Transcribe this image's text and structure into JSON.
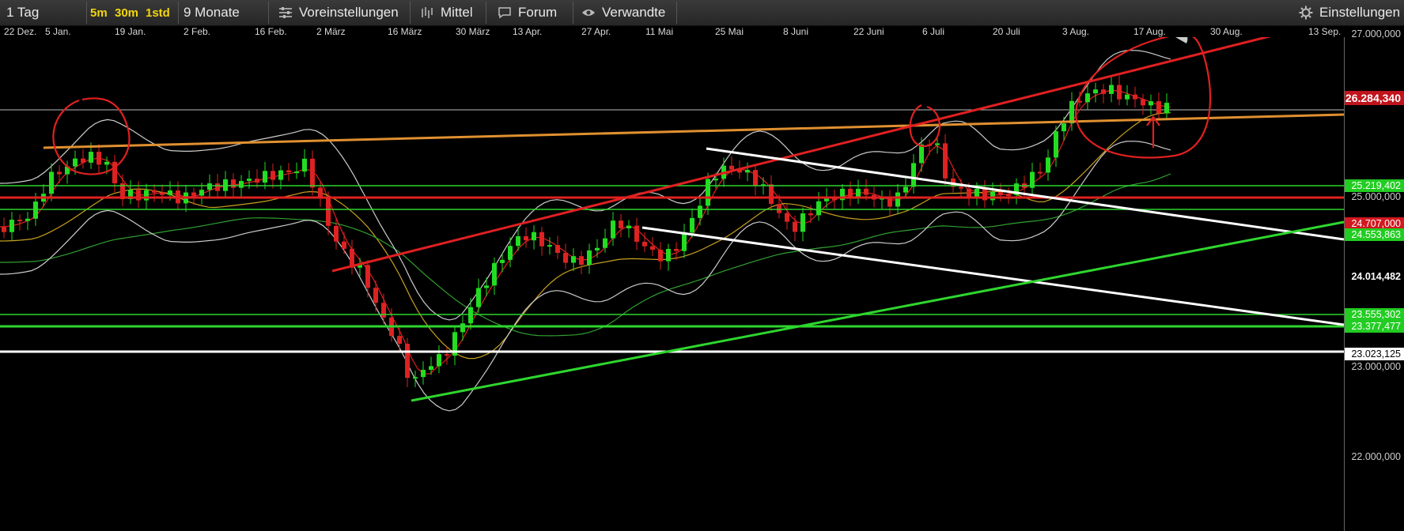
{
  "toolbar": {
    "timeframe": "1 Tag",
    "interval_5m": "5m",
    "interval_30m": "30m",
    "interval_1std": "1std",
    "range": "9 Monate",
    "presets": "Voreinstellungen",
    "average": "Mittel",
    "forum": "Forum",
    "related": "Verwandte",
    "settings": "Einstellungen"
  },
  "date_axis": [
    "22 Dez.",
    "5 Jan.",
    "19 Jan.",
    "2 Feb.",
    "16 Feb.",
    "2 März",
    "16 März",
    "30 März",
    "13 Apr.",
    "27 Apr.",
    "11 Mai",
    "25 Mai",
    "8 Juni",
    "22 Juni",
    "6 Juli",
    "20 Juli",
    "3 Aug.",
    "17 Aug.",
    "30 Aug.",
    "13 Sep."
  ],
  "price_axis": [
    "27.000,000",
    "25.000,000",
    "23.000,000",
    "22.000,000"
  ],
  "price_tags": {
    "current": "26.284,340",
    "green_1": "25.219,402",
    "red_1": "24.707,000",
    "green_2": "24.553,863",
    "white_1": "24.014,482",
    "green_3": "23.555,302",
    "green_4": "23.377,477",
    "white_2": "23.023,125"
  },
  "colors": {
    "background": "#000000",
    "up_candle": "#22dd22",
    "down_candle": "#dd2222",
    "resistance_red": "#e02020",
    "trend_orange": "#e09030",
    "support_green": "#2ed62e",
    "trend_white": "#ffffff",
    "annotation_red": "#e02020",
    "tag_current_bg": "#c0141c",
    "tag_green_bg": "#22cc22",
    "tag_red_bg": "#d01820"
  }
}
